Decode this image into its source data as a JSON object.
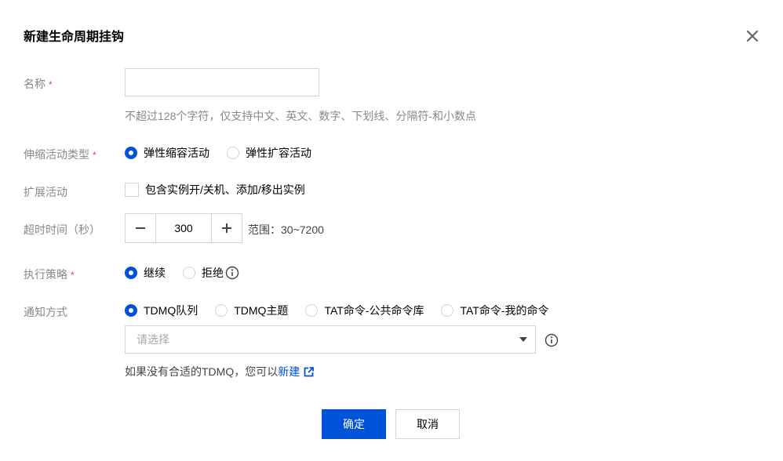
{
  "dialog": {
    "title": "新建生命周期挂钩"
  },
  "form": {
    "name": {
      "label": "名称",
      "required_mark": "*",
      "value": "",
      "hint": "不超过128个字符，仅支持中文、英文、数字、下划线、分隔符-和小数点"
    },
    "activity_type": {
      "label": "伸缩活动类型",
      "required_mark": "*",
      "options": [
        "弹性缩容活动",
        "弹性扩容活动"
      ],
      "selected": "弹性缩容活动"
    },
    "extended": {
      "label": "扩展活动",
      "checkbox_label": "包含实例开/关机、添加/移出实例",
      "checked": false
    },
    "timeout": {
      "label": "超时时间（秒）",
      "value": "300",
      "range_text": "范围：30~7200"
    },
    "policy": {
      "label": "执行策略",
      "required_mark": "*",
      "options": [
        "继续",
        "拒绝"
      ],
      "selected": "继续"
    },
    "notify": {
      "label": "通知方式",
      "options": [
        "TDMQ队列",
        "TDMQ主题",
        "TAT命令-公共命令库",
        "TAT命令-我的命令"
      ],
      "selected": "TDMQ队列",
      "select_placeholder": "请选择",
      "note_prefix": "如果没有合适的TDMQ，您可以",
      "note_link": "新建"
    }
  },
  "footer": {
    "confirm_label": "确定",
    "cancel_label": "取消"
  },
  "icons": {
    "close": "close-icon",
    "minus": "minus-icon",
    "plus": "plus-icon",
    "info": "info-icon",
    "external": "external-link-icon",
    "dropdown": "caret-down-icon"
  },
  "colors": {
    "primary": "#0052d9",
    "required": "#e54545",
    "label": "#888888",
    "border": "#cfd5de"
  }
}
